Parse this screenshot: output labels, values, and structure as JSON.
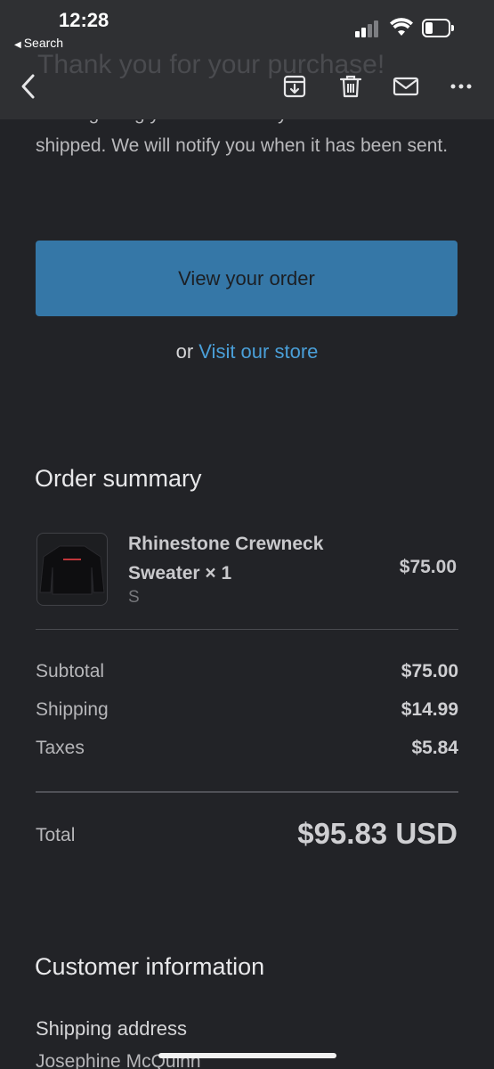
{
  "status_bar": {
    "time": "12:28",
    "back_app": "Search"
  },
  "toolbar": {
    "back_icon": "chevron-left-icon",
    "archive_icon": "archive-icon",
    "trash_icon": "trash-icon",
    "mail_icon": "mail-icon",
    "more_icon": "ellipsis-icon"
  },
  "email": {
    "ghost_title": "Thank you for your purchase!",
    "partial_line": "We're getting your order ready to be",
    "intro_text": "shipped. We will notify you when it has been sent.",
    "view_order_button": "View your order",
    "or_text": "or",
    "visit_store_link": "Visit our store"
  },
  "order_summary": {
    "title": "Order summary",
    "item": {
      "name": "Rhinestone Crewneck Sweater × 1",
      "variant": "S",
      "price": "$75.00",
      "thumbnail_icon": "sweater-image"
    },
    "rows": [
      {
        "label": "Subtotal",
        "value": "$75.00"
      },
      {
        "label": "Shipping",
        "value": "$14.99"
      },
      {
        "label": "Taxes",
        "value": "$5.84"
      }
    ],
    "total_label": "Total",
    "total_value": "$95.83 USD"
  },
  "customer_information": {
    "title": "Customer information",
    "shipping_address_label": "Shipping address",
    "shipping_name": "Josephine McQuinn"
  },
  "colors": {
    "background": "#222327",
    "button": "#3577a7",
    "link": "#4a9fd8"
  }
}
